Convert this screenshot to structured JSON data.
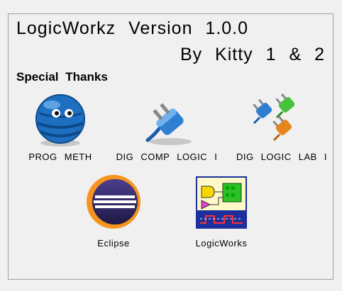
{
  "header": {
    "title": "LogicWorkz Version 1.0.0",
    "byline": "By Kitty 1 & 2"
  },
  "section_label": "Special Thanks",
  "credits": [
    {
      "label": "PROG METH",
      "icon": "globe-face-icon"
    },
    {
      "label": "DIG COMP LOGIC I",
      "icon": "blue-plug-icon"
    },
    {
      "label": "DIG LOGIC LAB I",
      "icon": "colored-plugs-icon"
    },
    {
      "label": "Eclipse",
      "icon": "eclipse-icon"
    },
    {
      "label": "LogicWorks",
      "icon": "logicworks-icon"
    }
  ],
  "colors": {
    "background": "#f0f0f0",
    "panel_border": "#a0a0a0",
    "accent_blue": "#2f7fd0"
  }
}
